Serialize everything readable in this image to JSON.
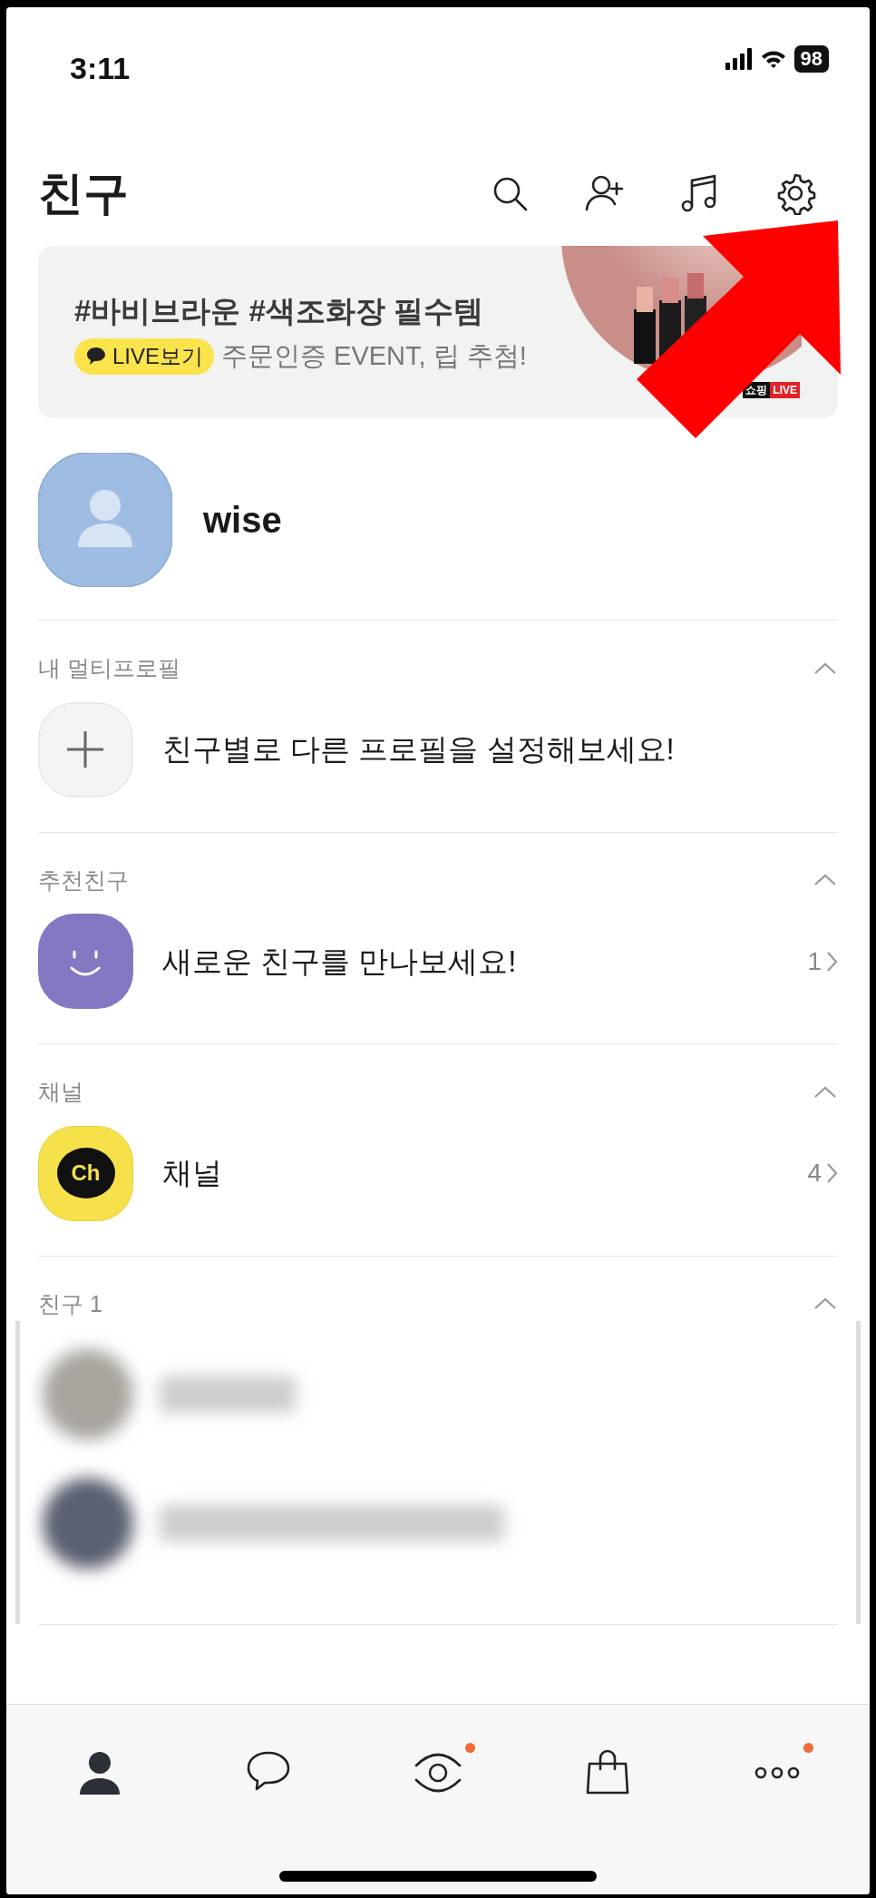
{
  "status_bar": {
    "time": "3:11",
    "battery": "98"
  },
  "header": {
    "title": "친구",
    "actions": [
      {
        "kind": "search"
      },
      {
        "kind": "add-friend"
      },
      {
        "kind": "music"
      },
      {
        "kind": "settings"
      }
    ]
  },
  "banner": {
    "title": "#바비브라운 #색조화장 필수템",
    "pill": "LIVE보기",
    "subtitle": "주문인증 EVENT, 립 추첨!",
    "tag": [
      "쇼핑",
      "LIVE"
    ]
  },
  "profile": {
    "name": "wise"
  },
  "sections": [
    {
      "title": "내 멀티프로필",
      "expanded": true,
      "rows": [
        {
          "kind": "plus",
          "text": "친구별로 다른 프로필을 설정해보세요!"
        }
      ]
    },
    {
      "title": "추천친구",
      "expanded": true,
      "rows": [
        {
          "kind": "smile",
          "text": "새로운 친구를 만나보세요!",
          "count": "1"
        }
      ]
    },
    {
      "title": "채널",
      "expanded": true,
      "rows": [
        {
          "kind": "channel",
          "icon_text": "Ch",
          "text": "채널",
          "count": "4"
        }
      ]
    },
    {
      "title": "친구 1",
      "expanded": true,
      "rows": [
        {
          "kind": "blurred"
        },
        {
          "kind": "blurred"
        }
      ]
    }
  ],
  "tabs": [
    {
      "kind": "friends",
      "selected": true,
      "badge": false
    },
    {
      "kind": "chat",
      "selected": false,
      "badge": false
    },
    {
      "kind": "view",
      "selected": false,
      "badge": true
    },
    {
      "kind": "shopping",
      "selected": false,
      "badge": false
    },
    {
      "kind": "more",
      "selected": false,
      "badge": true
    }
  ]
}
